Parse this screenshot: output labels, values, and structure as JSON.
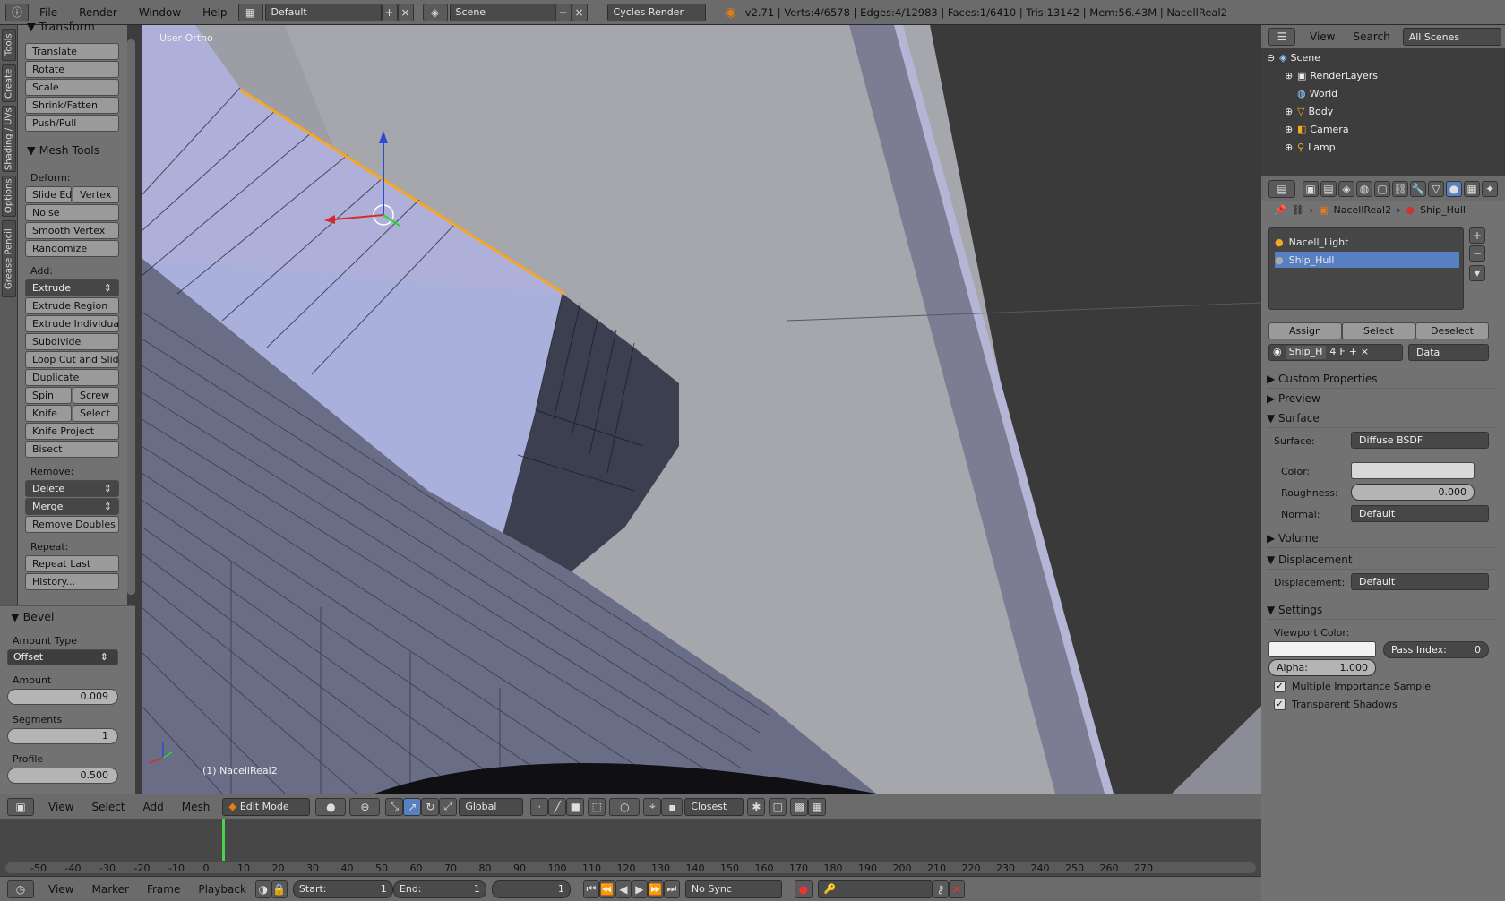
{
  "topbar": {
    "menus": [
      "File",
      "Render",
      "Window",
      "Help"
    ],
    "screen_layout": "Default",
    "scene": "Scene",
    "render_engine": "Cycles Render",
    "stats": "v2.71 | Verts:4/6578 | Edges:4/12983 | Faces:1/6410 | Tris:13142 | Mem:56.43M | NacellReal2"
  },
  "tool_tabs": [
    "Tools",
    "Create",
    "Shading / UVs",
    "Options",
    "Grease Pencil"
  ],
  "toolshelf": {
    "transform_header": "Transform",
    "transform": [
      "Translate",
      "Rotate",
      "Scale",
      "Shrink/Fatten",
      "Push/Pull"
    ],
    "mesh_tools_header": "Mesh Tools",
    "deform_label": "Deform:",
    "slide_edge": "Slide Ed",
    "vertex": "Vertex",
    "noise": "Noise",
    "smooth_vertex": "Smooth Vertex",
    "randomize": "Randomize",
    "add_label": "Add:",
    "extrude": "Extrude",
    "extrude_region": "Extrude Region",
    "extrude_individual": "Extrude Individual",
    "subdivide": "Subdivide",
    "loop_cut": "Loop Cut and Slide",
    "duplicate": "Duplicate",
    "spin": "Spin",
    "screw": "Screw",
    "knife": "Knife",
    "knife_select": "Select",
    "knife_project": "Knife Project",
    "bisect": "Bisect",
    "remove_label": "Remove:",
    "delete": "Delete",
    "merge": "Merge",
    "remove_doubles": "Remove Doubles",
    "repeat_label": "Repeat:",
    "repeat_last": "Repeat Last",
    "history": "History..."
  },
  "bevel": {
    "header": "Bevel",
    "amount_type_label": "Amount Type",
    "amount_type": "Offset",
    "amount_label": "Amount",
    "amount": "0.009",
    "segments_label": "Segments",
    "segments": "1",
    "profile_label": "Profile",
    "profile": "0.500"
  },
  "viewport": {
    "view_label": "User Ortho",
    "object_label": "(1) NacellReal2"
  },
  "viewport_header": {
    "menus": [
      "View",
      "Select",
      "Add",
      "Mesh"
    ],
    "mode": "Edit Mode",
    "orientation": "Global",
    "snap": "Closest"
  },
  "timeline": {
    "ticks": [
      "-50",
      "-40",
      "-30",
      "-20",
      "-10",
      "0",
      "10",
      "20",
      "30",
      "40",
      "50",
      "60",
      "70",
      "80",
      "90",
      "100",
      "110",
      "120",
      "130",
      "140",
      "150",
      "160",
      "170",
      "180",
      "190",
      "200",
      "210",
      "220",
      "230",
      "240",
      "250",
      "260",
      "270"
    ],
    "current_frame": 1,
    "menus": [
      "View",
      "Marker",
      "Frame",
      "Playback"
    ],
    "start_label": "Start:",
    "start": "1",
    "end_label": "End:",
    "end": "1",
    "frame": "1",
    "sync": "No Sync"
  },
  "outliner": {
    "menus": [
      "View",
      "Search"
    ],
    "filter": "All Scenes",
    "items": [
      "Scene",
      "RenderLayers",
      "World",
      "Body",
      "Camera",
      "Lamp"
    ]
  },
  "properties": {
    "breadcrumb_object": "NacellReal2",
    "breadcrumb_material": "Ship_Hull",
    "slots": [
      "Nacell_Light",
      "Ship_Hull"
    ],
    "assign": "Assign",
    "select": "Select",
    "deselect": "Deselect",
    "material_name": "Ship_H",
    "users": "4",
    "fake_user": "F",
    "link": "Data",
    "custom_properties": "Custom Properties",
    "preview": "Preview",
    "surface_header": "Surface",
    "surface_label": "Surface:",
    "surface_value": "Diffuse BSDF",
    "color_label": "Color:",
    "roughness_label": "Roughness:",
    "roughness": "0.000",
    "normal_label": "Normal:",
    "normal": "Default",
    "volume": "Volume",
    "displacement_header": "Displacement",
    "displacement_label": "Displacement:",
    "displacement": "Default",
    "settings_header": "Settings",
    "viewport_color_label": "Viewport Color:",
    "pass_index_label": "Pass Index:",
    "pass_index": "0",
    "alpha_label": "Alpha:",
    "alpha": "1.000",
    "mis": "Multiple Importance Sample",
    "transparent_shadows": "Transparent Shadows"
  },
  "colors": {
    "selection": "#5680c2",
    "accent_orange": "#f5a623",
    "frame_marker": "#4ad14a"
  }
}
